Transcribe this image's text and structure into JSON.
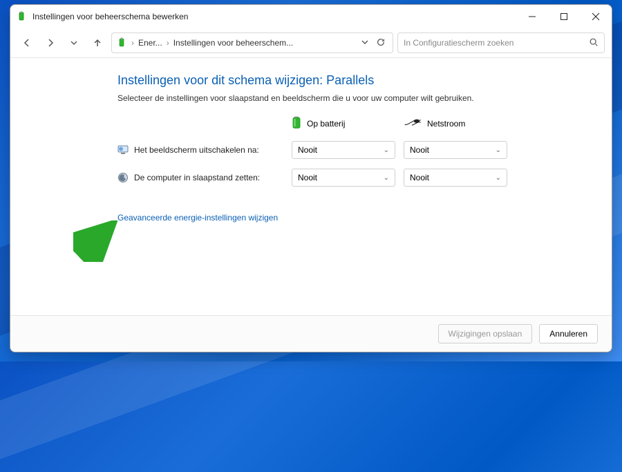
{
  "window": {
    "title": "Instellingen voor beheerschema bewerken"
  },
  "breadcrumb": {
    "item1": "Ener...",
    "item2": "Instellingen voor beheerschem..."
  },
  "search": {
    "placeholder": "In Configuratiescherm zoeken"
  },
  "page": {
    "title_prefix": "Instellingen voor dit schema wijzigen:",
    "plan_name": "Parallels",
    "subtitle": "Selecteer de instellingen voor slaapstand en beeldscherm die u voor uw computer wilt gebruiken."
  },
  "columns": {
    "battery": "Op batterij",
    "plugged": "Netstroom"
  },
  "settings": {
    "display_off": {
      "label": "Het beeldscherm uitschakelen na:",
      "battery_value": "Nooit",
      "plugged_value": "Nooit"
    },
    "sleep": {
      "label": "De computer in slaapstand zetten:",
      "battery_value": "Nooit",
      "plugged_value": "Nooit"
    }
  },
  "links": {
    "advanced": "Geavanceerde energie-instellingen wijzigen"
  },
  "buttons": {
    "save": "Wijzigingen opslaan",
    "cancel": "Annuleren"
  }
}
